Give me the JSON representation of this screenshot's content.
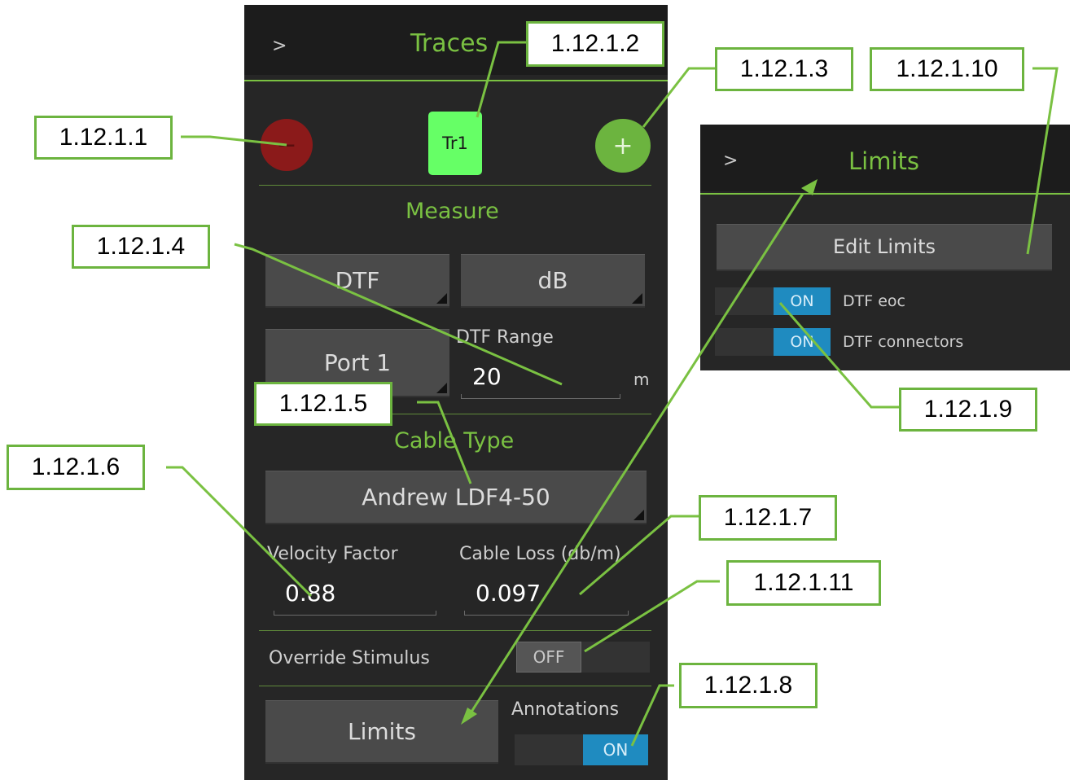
{
  "colors": {
    "accent": "#7ac142",
    "panel_bg": "#262626",
    "toggle_on": "#1f8bc0",
    "remove": "#8b1a1a",
    "trace_active": "#66ff66"
  },
  "traces_panel": {
    "collapse_glyph": ">",
    "title": "Traces",
    "remove_glyph": "−",
    "trace_tab": "Tr1",
    "add_glyph": "+",
    "measure_heading": "Measure",
    "format_button": "DTF",
    "units_button": "dB",
    "port_button": "Port 1",
    "dtf_range_label": "DTF Range",
    "dtf_range_value": "20",
    "dtf_range_unit": "m",
    "cable_type_heading": "Cable Type",
    "cable_type_button": "Andrew LDF4-50",
    "velocity_factor_label": "Velocity Factor",
    "velocity_factor_value": "0.88",
    "cable_loss_label": "Cable Loss (db/m)",
    "cable_loss_value": "0.097",
    "override_stimulus_label": "Override Stimulus",
    "override_stimulus_state": "OFF",
    "limits_button": "Limits",
    "annotations_label": "Annotations",
    "annotations_state": "ON"
  },
  "limits_panel": {
    "collapse_glyph": ">",
    "title": "Limits",
    "edit_limits_button": "Edit Limits",
    "toggles": [
      {
        "state": "ON",
        "label": "DTF eoc"
      },
      {
        "state": "ON",
        "label": "DTF connectors"
      }
    ]
  },
  "callouts": {
    "c1": "1.12.1.1",
    "c2": "1.12.1.2",
    "c3": "1.12.1.3",
    "c4": "1.12.1.4",
    "c5": "1.12.1.5",
    "c6": "1.12.1.6",
    "c7": "1.12.1.7",
    "c8": "1.12.1.8",
    "c9": "1.12.1.9",
    "c10": "1.12.1.10",
    "c11": "1.12.1.11"
  }
}
